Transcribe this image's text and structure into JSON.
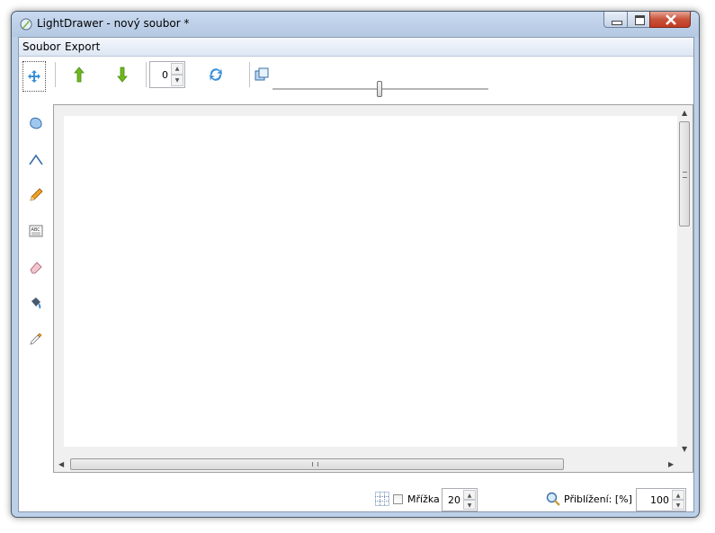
{
  "window": {
    "title": "LightDrawer - nový soubor *"
  },
  "menu": {
    "items": [
      {
        "label": "Soubor"
      },
      {
        "label": "Export"
      }
    ]
  },
  "toolbar": {
    "icons": [
      "move-icon",
      "arrow-up-icon",
      "arrow-down-icon",
      "rotate-icon",
      "layer-icon"
    ],
    "layer_value": "0"
  },
  "tools": [
    "move-tool-icon",
    "shape-tool-icon",
    "polyline-tool-icon",
    "pencil-tool-icon",
    "text-tool-icon",
    "eraser-tool-icon",
    "fill-bucket-icon",
    "eyedropper-icon"
  ],
  "status": {
    "grid_label": "Mřížka",
    "grid_checked": false,
    "grid_size": "20",
    "zoom_label": "Přiblížení: [%]",
    "zoom_value": "100"
  },
  "colors": {
    "accent": "#3a8fd6",
    "arrow_green": "#6fb81e",
    "pencil": "#f0a020",
    "close": "#c7533a"
  }
}
